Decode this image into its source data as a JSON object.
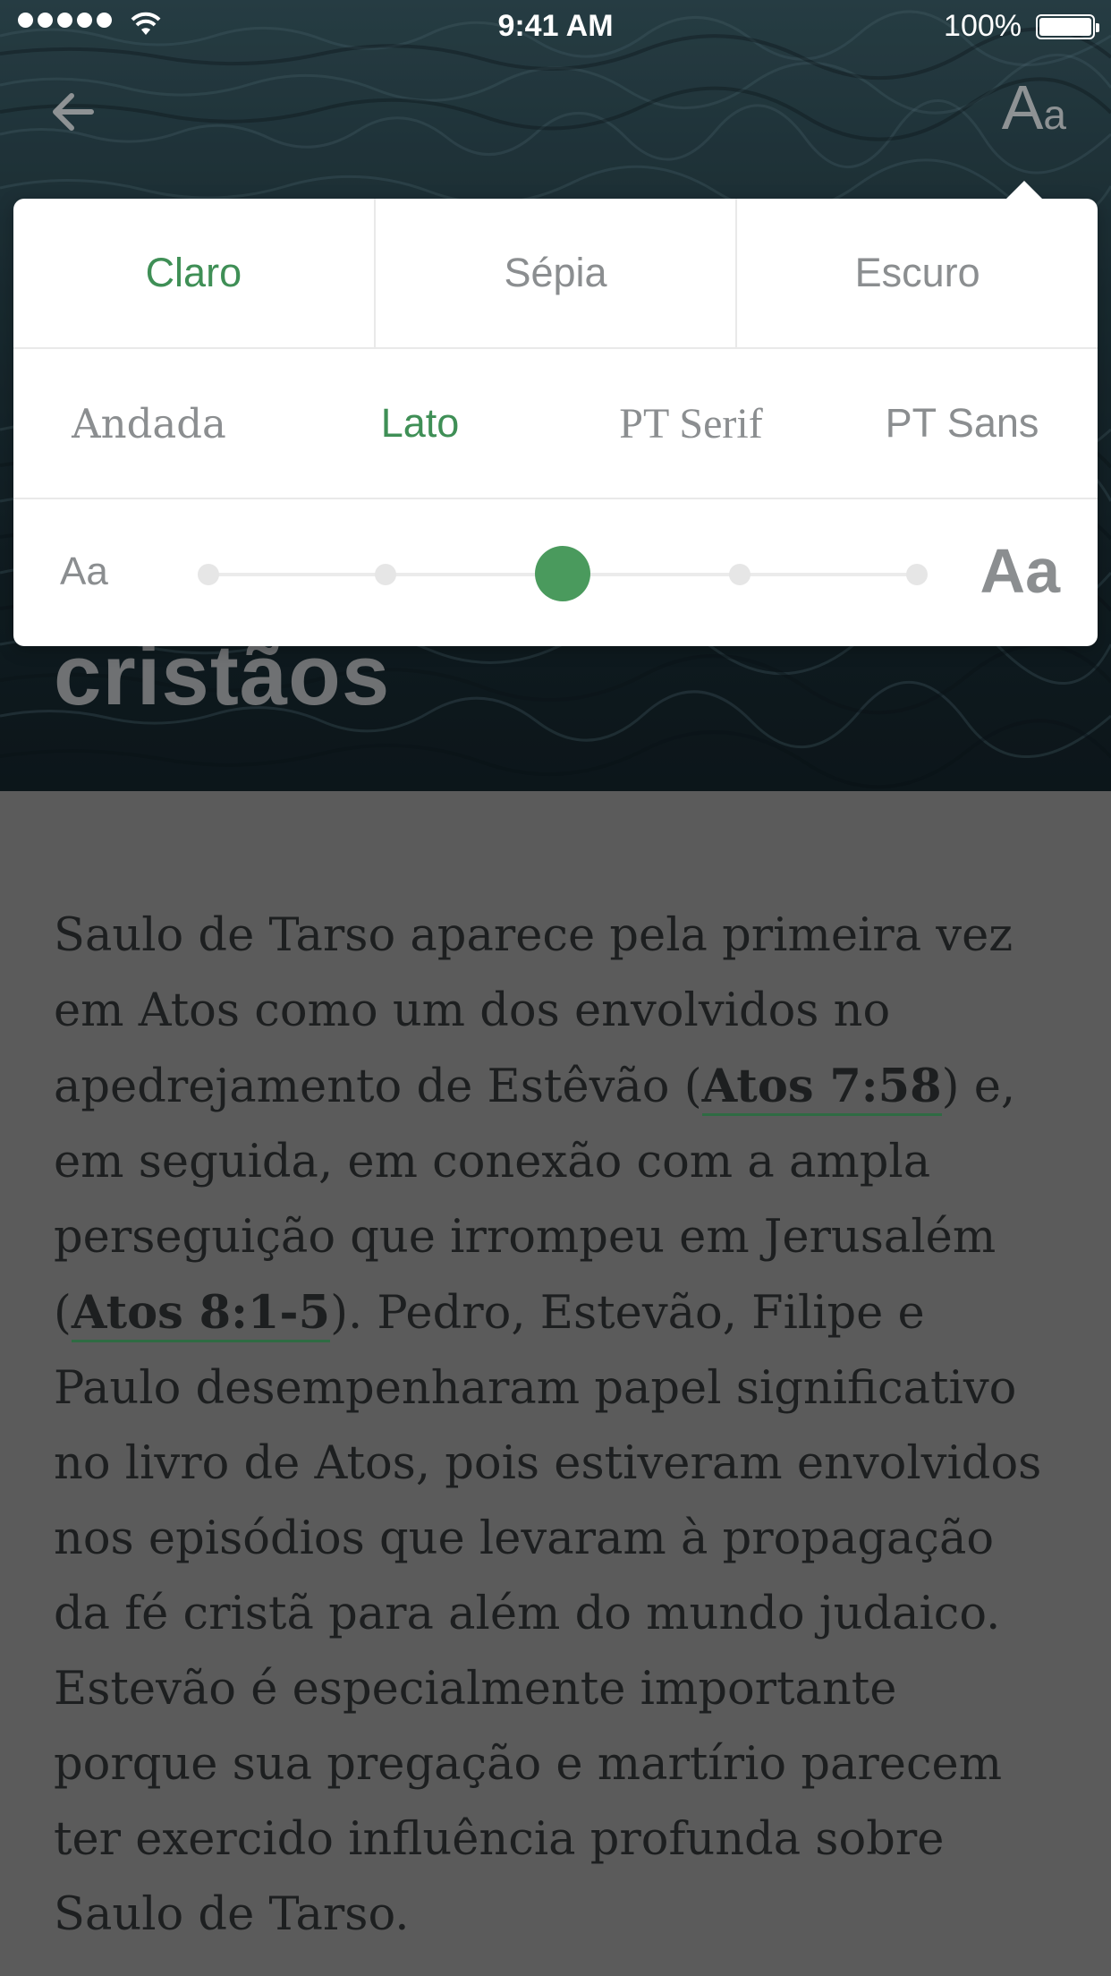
{
  "status_bar": {
    "time": "9:41 AM",
    "battery_percent": "100%"
  },
  "nav": {
    "back_icon": "arrow-left-icon",
    "text_settings": {
      "big": "A",
      "small": "a"
    }
  },
  "headline": "cristãos",
  "settings": {
    "themes": [
      {
        "label": "Claro",
        "active": true
      },
      {
        "label": "Sépia",
        "active": false
      },
      {
        "label": "Escuro",
        "active": false
      }
    ],
    "fonts": [
      {
        "label": "Andada",
        "active": false
      },
      {
        "label": "Lato",
        "active": true
      },
      {
        "label": "PT Serif",
        "active": false
      },
      {
        "label": "PT Sans",
        "active": false
      }
    ],
    "size": {
      "small_label": "Aa",
      "large_label": "Aa",
      "stops": 5,
      "selected_index": 2
    },
    "accent_color": "#4a9a5d"
  },
  "article": {
    "seg1": "Saulo de Tarso aparece pela primeira vez em Atos como um dos envolvidos no apedrejamento de Estêvão (",
    "ref1": "Atos 7:58",
    "seg2": ") e, em seguida, em conexão com a ampla perseguição que irrompeu em Jerusalém (",
    "ref2": "Atos 8:1-5",
    "seg3": "). Pedro, Estevão, Filipe e Paulo desempenharam papel significativo no livro de Atos, pois estiveram envolvidos nos episódios que levaram à propagação da fé cristã para além do mundo judaico. Estevão é especialmente importante porque sua pregação e martírio parecem ter exercido influência profunda sobre Saulo de Tarso."
  }
}
